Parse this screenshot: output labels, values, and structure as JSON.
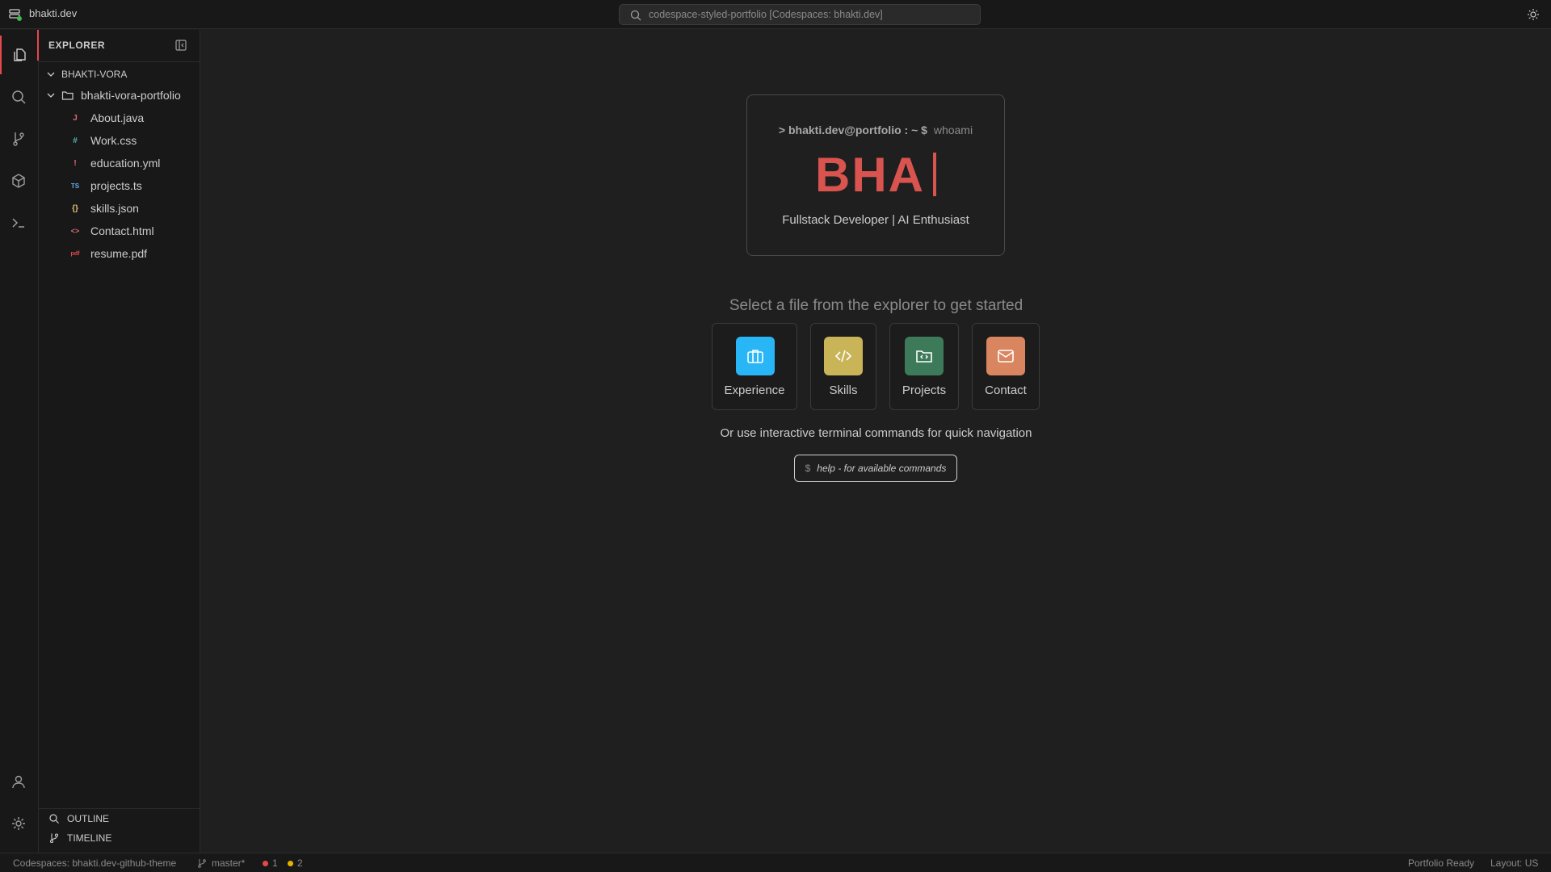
{
  "titlebar": {
    "app_name": "bhakti.dev",
    "command_center": "codespace-styled-portfolio [Codespaces: bhakti.dev]"
  },
  "sidebar": {
    "title": "EXPLORER",
    "root": "BHAKTI-VORA",
    "folder": "bhakti-vora-portfolio",
    "files": [
      {
        "icon": "J",
        "name": "About.java",
        "color": "#e06c75"
      },
      {
        "icon": "#",
        "name": "Work.css",
        "color": "#56b6c2"
      },
      {
        "icon": "!",
        "name": "education.yml",
        "color": "#e06c75"
      },
      {
        "icon": "TS",
        "name": "projects.ts",
        "color": "#61afef"
      },
      {
        "icon": "{}",
        "name": "skills.json",
        "color": "#e5c07b"
      },
      {
        "icon": "<>",
        "name": "Contact.html",
        "color": "#e06c75"
      },
      {
        "icon": "pdf",
        "name": "resume.pdf",
        "color": "#e5484d"
      }
    ],
    "outline": "OUTLINE",
    "timeline": "TIMELINE"
  },
  "main": {
    "prompt_host": "> bhakti.dev@portfolio : ~ $",
    "prompt_cmd": "whoami",
    "typed_name": "BHA",
    "role": "Fullstack Developer | AI Enthusiast",
    "select_message": "Select a file from the explorer to get started",
    "cards": [
      {
        "label": "Experience",
        "color": "#29b6f6"
      },
      {
        "label": "Skills",
        "color": "#c9b458"
      },
      {
        "label": "Projects",
        "color": "#3d7a5a"
      },
      {
        "label": "Contact",
        "color": "#d98560"
      }
    ],
    "hint": "Or use interactive terminal commands for quick navigation",
    "help_dollar": "$",
    "help_text": "help - for available commands"
  },
  "statusbar": {
    "codespace": "Codespaces: bhakti.dev-github-theme",
    "branch": "master*",
    "errors": "1",
    "warnings": "2",
    "ready": "Portfolio Ready",
    "layout": "Layout: US"
  }
}
